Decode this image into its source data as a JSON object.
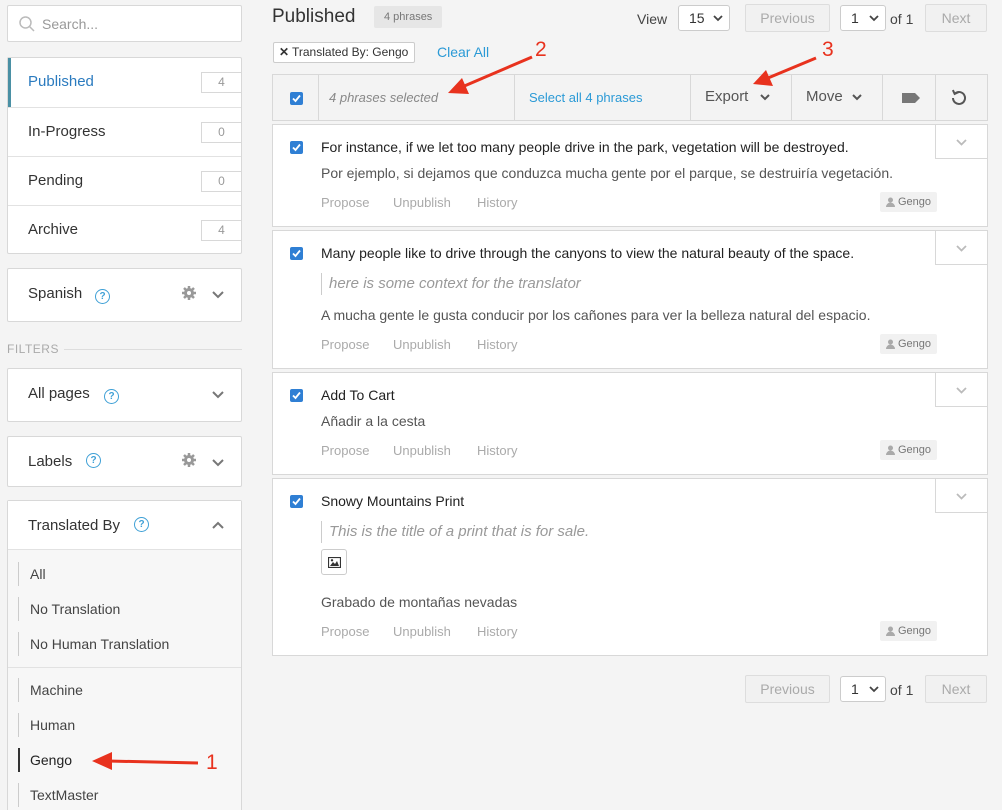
{
  "sidebar": {
    "search_placeholder": "Search...",
    "statuses": [
      {
        "label": "Published",
        "count": "4",
        "active": true
      },
      {
        "label": "In-Progress",
        "count": "0"
      },
      {
        "label": "Pending",
        "count": "0"
      },
      {
        "label": "Archive",
        "count": "4"
      }
    ],
    "language": "Spanish",
    "filters_label": "FILTERS",
    "all_pages": "All pages",
    "labels": "Labels",
    "translated_by": {
      "title": "Translated By",
      "items": [
        "All",
        "No Translation",
        "No Human Translation",
        "Machine",
        "Human",
        "Gengo",
        "TextMaster"
      ],
      "active": "Gengo"
    }
  },
  "header": {
    "title": "Published",
    "count_badge": "4 phrases",
    "view_label": "View",
    "view_value": "15",
    "previous": "Previous",
    "page_value": "1",
    "of_total": "of 1",
    "next": "Next"
  },
  "active_filter": {
    "label": "Translated By: Gengo",
    "clear_all": "Clear All"
  },
  "toolbar": {
    "selected_text": "4 phrases selected",
    "select_all": "Select all 4 phrases",
    "export": "Export",
    "move": "Move"
  },
  "phrases": [
    {
      "source": "For instance, if we let too many people drive in the park, vegetation will be destroyed.",
      "context": "",
      "translation": "Por ejemplo, si dejamos que conduzca mucha gente por el parque, se destruiría vegetación.",
      "translator": "Gengo"
    },
    {
      "source": "Many people like to drive through the canyons to view the natural beauty of the space.",
      "context": "here is some context for the translator",
      "translation": "A mucha gente le gusta conducir por los cañones para ver la belleza natural del espacio.",
      "translator": "Gengo"
    },
    {
      "source": "Add To Cart",
      "context": "",
      "translation": "Añadir a la cesta",
      "translator": "Gengo"
    },
    {
      "source": "Snowy Mountains Print",
      "context": "This is the title of a print that is for sale.",
      "translation": "Grabado de montañas nevadas",
      "translator": "Gengo"
    }
  ],
  "phrase_actions": {
    "propose": "Propose",
    "unpublish": "Unpublish",
    "history": "History"
  },
  "footer": {
    "previous": "Previous",
    "page_value": "1",
    "of_total": "of 1",
    "next": "Next"
  },
  "annotations": {
    "one": "1",
    "two": "2",
    "three": "3"
  },
  "colors": {
    "accent": "#2b9ad6",
    "checkbox": "#2f7fd4",
    "annotation": "#e8321e"
  }
}
